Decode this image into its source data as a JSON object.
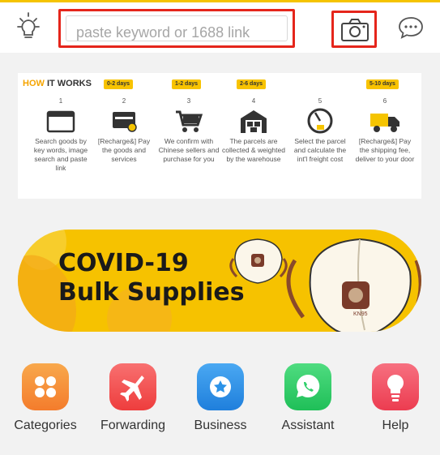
{
  "header": {
    "search_placeholder": "paste keyword or 1688 link"
  },
  "how_it_works": {
    "title_highlight": "HOW",
    "title_rest": " IT WORKS",
    "durations": [
      "0-2 days",
      "1-2 days",
      "2-6 days",
      "5-10 days"
    ],
    "steps": [
      {
        "num": "1",
        "icon": "browser-window-icon",
        "desc": "Search goods by key words, image search and paste link"
      },
      {
        "num": "2",
        "icon": "payment-card-icon",
        "desc": "[Recharge&] Pay the goods and services"
      },
      {
        "num": "3",
        "icon": "shopping-cart-icon",
        "desc": "We confirm with Chinese sellers and purchase for you"
      },
      {
        "num": "4",
        "icon": "warehouse-icon",
        "desc": "The parcels are collected & weighted by the warehouse"
      },
      {
        "num": "5",
        "icon": "scale-icon",
        "desc": "Select the parcel and calculate the int'l freight cost"
      },
      {
        "num": "6",
        "icon": "truck-icon",
        "desc": "[Recharge&] Pay the shipping fee, deliver to your door"
      }
    ]
  },
  "banner": {
    "line1": "COVID-19",
    "line2": "Bulk Supplies",
    "mask_label": "KN95"
  },
  "nav": [
    {
      "label": "Categories",
      "icon": "grid-icon",
      "color": "#f6963a"
    },
    {
      "label": "Forwarding",
      "icon": "airplane-icon",
      "color": "#f25252"
    },
    {
      "label": "Business",
      "icon": "star-badge-icon",
      "color": "#2c93e8"
    },
    {
      "label": "Assistant",
      "icon": "whatsapp-icon",
      "color": "#2fcf6a"
    },
    {
      "label": "Help",
      "icon": "lightbulb-icon",
      "color": "#f04e5e"
    }
  ],
  "colors": {
    "accent": "#f5c400",
    "highlight_border": "#e5251b"
  }
}
